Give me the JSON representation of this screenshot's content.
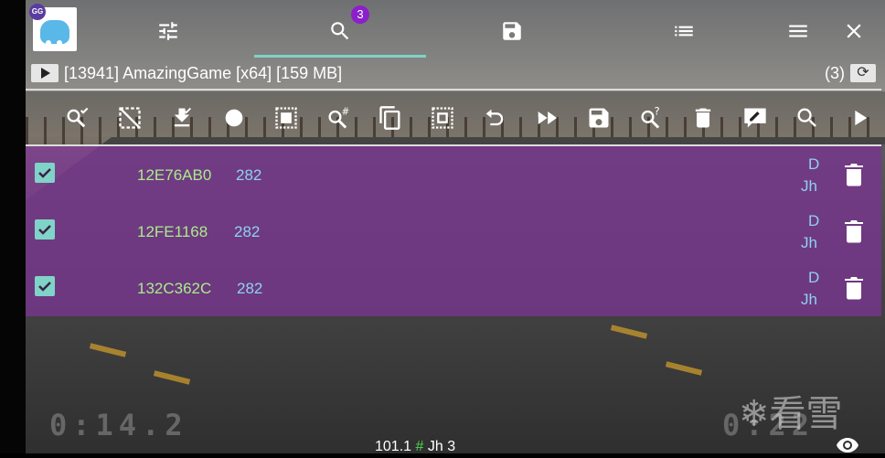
{
  "app": {
    "logo_text": "GG",
    "tab_badge": "3"
  },
  "tabs": [
    {
      "name": "settings-tab",
      "icon": "sliders-icon"
    },
    {
      "name": "search-tab",
      "icon": "search-icon",
      "active": true
    },
    {
      "name": "save-tab",
      "icon": "save-icon"
    },
    {
      "name": "list-tab",
      "icon": "list-icon"
    },
    {
      "name": "menu-tab",
      "icon": "hamburger-icon"
    },
    {
      "name": "close-tab",
      "icon": "close-icon"
    }
  ],
  "process": {
    "title": "[13941] AmazingGame [x64] [159 MB]",
    "count": "(3)"
  },
  "toolbar": [
    "search-refine-icon",
    "select-area-icon",
    "download-icon",
    "record-icon",
    "select-all-icon",
    "search-number-icon",
    "copy-icon",
    "select-box-icon",
    "undo-icon",
    "fast-forward-icon",
    "save-icon",
    "search-unknown-icon",
    "delete-icon",
    "edit-icon",
    "search-icon",
    "play-icon"
  ],
  "results": [
    {
      "address": "12E76AB0",
      "value": "282",
      "type_top": "D",
      "type_bottom": "Jh",
      "checked": true
    },
    {
      "address": "12FE1168",
      "value": "282",
      "type_top": "D",
      "type_bottom": "Jh",
      "checked": true
    },
    {
      "address": "132C362C",
      "value": "282",
      "type_top": "D",
      "type_bottom": "Jh",
      "checked": true
    }
  ],
  "status": {
    "value": "101.1",
    "hash": "#",
    "type": "Jh 3"
  },
  "game_hud": {
    "timer_left": "0:14.2",
    "timer_right": "0:22",
    "watermark": "❄看雪"
  },
  "colors": {
    "accent": "#7fd3c8",
    "result_bg": "#76368c",
    "address": "#a9ec8a",
    "value": "#8fd0f5",
    "badge": "#8b1fc9"
  }
}
